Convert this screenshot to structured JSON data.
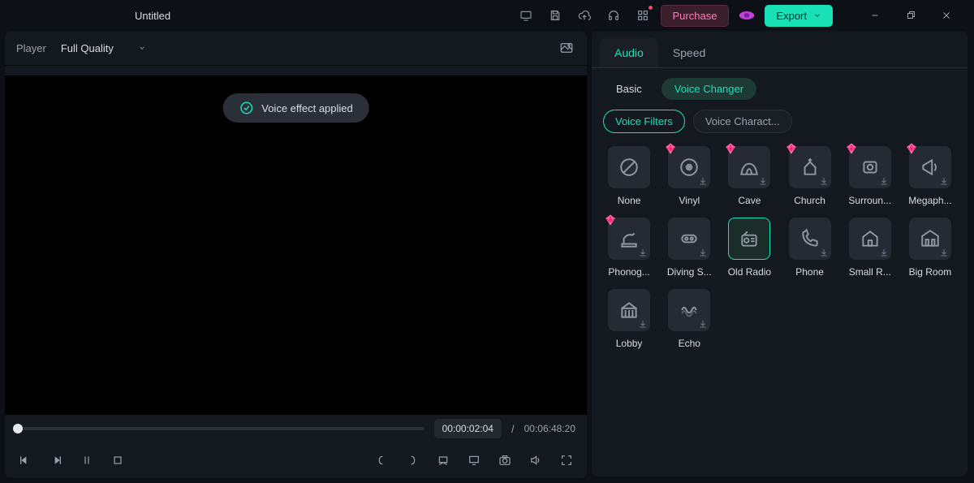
{
  "titlebar": {
    "title": "Untitled",
    "purchase": "Purchase",
    "export": "Export"
  },
  "player": {
    "label": "Player",
    "quality": "Full Quality",
    "toast": "Voice effect applied",
    "current_time": "00:00:02:04",
    "separator": "/",
    "duration": "00:06:48:20"
  },
  "rightPanel": {
    "tabs": {
      "audio": "Audio",
      "speed": "Speed"
    },
    "subtabs": {
      "basic": "Basic",
      "voice_changer": "Voice Changer"
    },
    "chips": {
      "filters": "Voice Filters",
      "characters": "Voice Charact..."
    },
    "filters": [
      {
        "key": "none",
        "label": "None",
        "premium": false,
        "dl": false
      },
      {
        "key": "vinyl",
        "label": "Vinyl",
        "premium": true,
        "dl": true
      },
      {
        "key": "cave",
        "label": "Cave",
        "premium": true,
        "dl": true
      },
      {
        "key": "church",
        "label": "Church",
        "premium": true,
        "dl": true
      },
      {
        "key": "surround",
        "label": "Surroun...",
        "premium": true,
        "dl": true
      },
      {
        "key": "megaphone",
        "label": "Megaph...",
        "premium": true,
        "dl": true
      },
      {
        "key": "phonograph",
        "label": "Phonog...",
        "premium": true,
        "dl": true
      },
      {
        "key": "diving",
        "label": "Diving S...",
        "premium": false,
        "dl": true
      },
      {
        "key": "oldradio",
        "label": "Old Radio",
        "premium": false,
        "dl": false,
        "selected": true
      },
      {
        "key": "phone",
        "label": "Phone",
        "premium": false,
        "dl": true
      },
      {
        "key": "smallroom",
        "label": "Small R...",
        "premium": false,
        "dl": true
      },
      {
        "key": "bigroom",
        "label": "Big Room",
        "premium": false,
        "dl": true
      },
      {
        "key": "lobby",
        "label": "Lobby",
        "premium": false,
        "dl": true
      },
      {
        "key": "echo",
        "label": "Echo",
        "premium": false,
        "dl": true
      }
    ]
  }
}
